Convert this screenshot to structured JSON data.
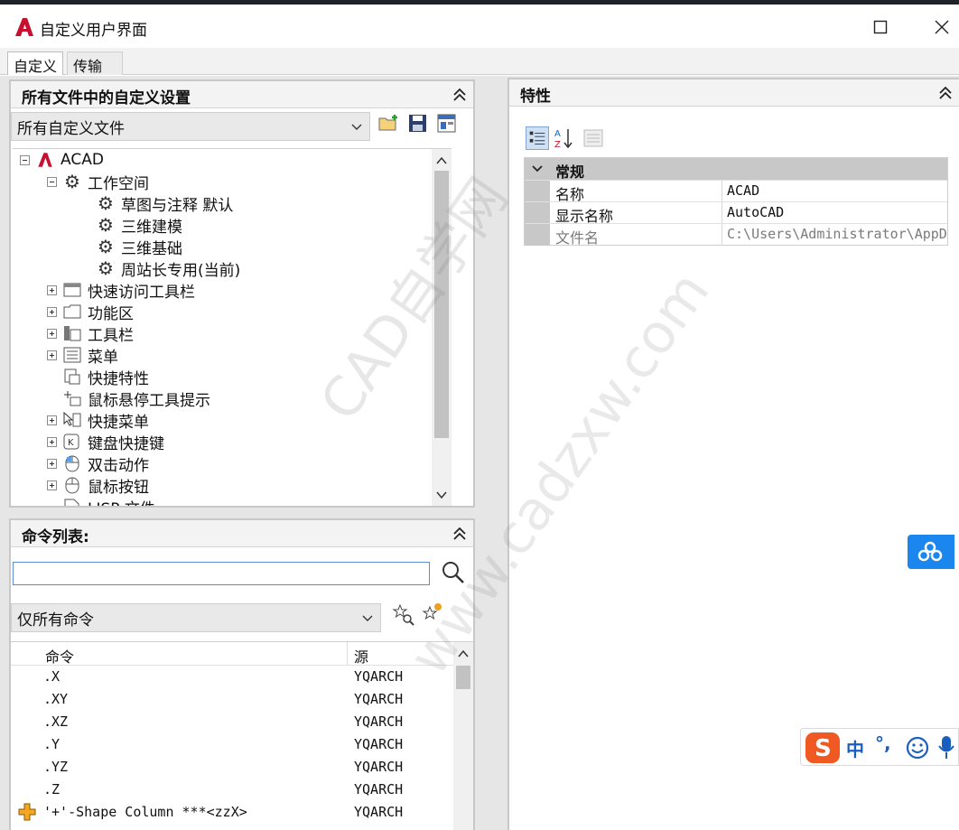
{
  "window": {
    "title": "自定义用户界面"
  },
  "tabs": [
    {
      "label": "自定义"
    },
    {
      "label": "传输"
    }
  ],
  "left_top": {
    "header": "所有文件中的自定义设置",
    "filter": "所有自定义文件",
    "tree": [
      {
        "label": "ACAD"
      },
      {
        "label": "工作空间"
      },
      {
        "label": "草图与注释 默认"
      },
      {
        "label": "三维建模"
      },
      {
        "label": "三维基础"
      },
      {
        "label": "周站长专用(当前)"
      },
      {
        "label": "快速访问工具栏"
      },
      {
        "label": "功能区"
      },
      {
        "label": "工具栏"
      },
      {
        "label": "菜单"
      },
      {
        "label": "快捷特性"
      },
      {
        "label": "鼠标悬停工具提示"
      },
      {
        "label": "快捷菜单"
      },
      {
        "label": "键盘快捷键"
      },
      {
        "label": "双击动作"
      },
      {
        "label": "鼠标按钮"
      },
      {
        "label": "LISP 文件"
      }
    ]
  },
  "left_bottom": {
    "header": "命令列表:",
    "search_value": "",
    "filter": "仅所有命令",
    "columns": {
      "name": "命令",
      "source": "源"
    },
    "rows": [
      {
        "name": ".X",
        "source": "YQARCH"
      },
      {
        "name": ".XY",
        "source": "YQARCH"
      },
      {
        "name": ".XZ",
        "source": "YQARCH"
      },
      {
        "name": ".Y",
        "source": "YQARCH"
      },
      {
        "name": ".YZ",
        "source": "YQARCH"
      },
      {
        "name": ".Z",
        "source": "YQARCH"
      },
      {
        "name": "'+'-Shape Column     ***<zzX>",
        "source": "YQARCH"
      }
    ]
  },
  "properties": {
    "header": "特性",
    "category": "常规",
    "rows": [
      {
        "key": "名称",
        "value": "ACAD"
      },
      {
        "key": "显示名称",
        "value": "AutoCAD"
      },
      {
        "key": "文件名",
        "value": "C:\\Users\\Administrator\\AppD"
      }
    ]
  },
  "ime": {
    "lang": "中",
    "punct": "°,"
  },
  "watermark": {
    "line1": "CAD自学网",
    "line2": "www.cadzxw.com"
  },
  "colors": {
    "accent": "#1a86ee",
    "autocad_red": "#c8102e"
  }
}
